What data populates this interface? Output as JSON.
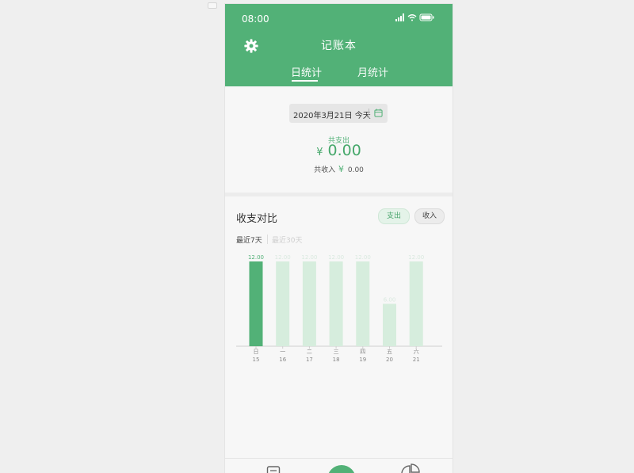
{
  "status_bar": {
    "time": "08:00"
  },
  "header": {
    "title": "记账本",
    "tabs": [
      {
        "label": "日统计",
        "active": true
      },
      {
        "label": "月统计",
        "active": false
      }
    ]
  },
  "summary": {
    "date": "2020年3月21日",
    "today_label": "今天",
    "spend_label": "共支出",
    "currency": "¥",
    "spend_amount": "0.00",
    "income_label": "共收入",
    "income_amount": "0.00"
  },
  "compare": {
    "title": "收支对比",
    "toggle": {
      "expense_label": "支出",
      "income_label": "收入",
      "active": "expense"
    },
    "ranges": [
      {
        "label": "最近7天",
        "active": true
      },
      {
        "label": "最近30天",
        "active": false
      }
    ]
  },
  "chart_data": {
    "type": "bar",
    "categories": [
      "日 15",
      "一 16",
      "二 17",
      "三 18",
      "四 19",
      "五 20",
      "六 21"
    ],
    "weekday_labels": [
      "日",
      "一",
      "二",
      "三",
      "四",
      "五",
      "六"
    ],
    "date_labels": [
      "15",
      "16",
      "17",
      "18",
      "19",
      "20",
      "21"
    ],
    "values": [
      12,
      12,
      12,
      12,
      12,
      6,
      12
    ],
    "value_labels": [
      "12.00",
      "12.00",
      "12.00",
      "12.00",
      "12.00",
      "6.00",
      "12.00"
    ],
    "highlight_index": 0,
    "ylim": [
      0,
      12
    ],
    "colors": {
      "highlight": "#52b177",
      "normal": "#d6eddd",
      "label_highlight": "#52b177",
      "label_normal": "#d9e9df",
      "axis": "#cfcfcf"
    }
  },
  "colors": {
    "brand": "#52b177"
  },
  "bottom_nav": {
    "icons": [
      "bill-icon",
      "edit-icon",
      "pie-chart-icon"
    ]
  }
}
